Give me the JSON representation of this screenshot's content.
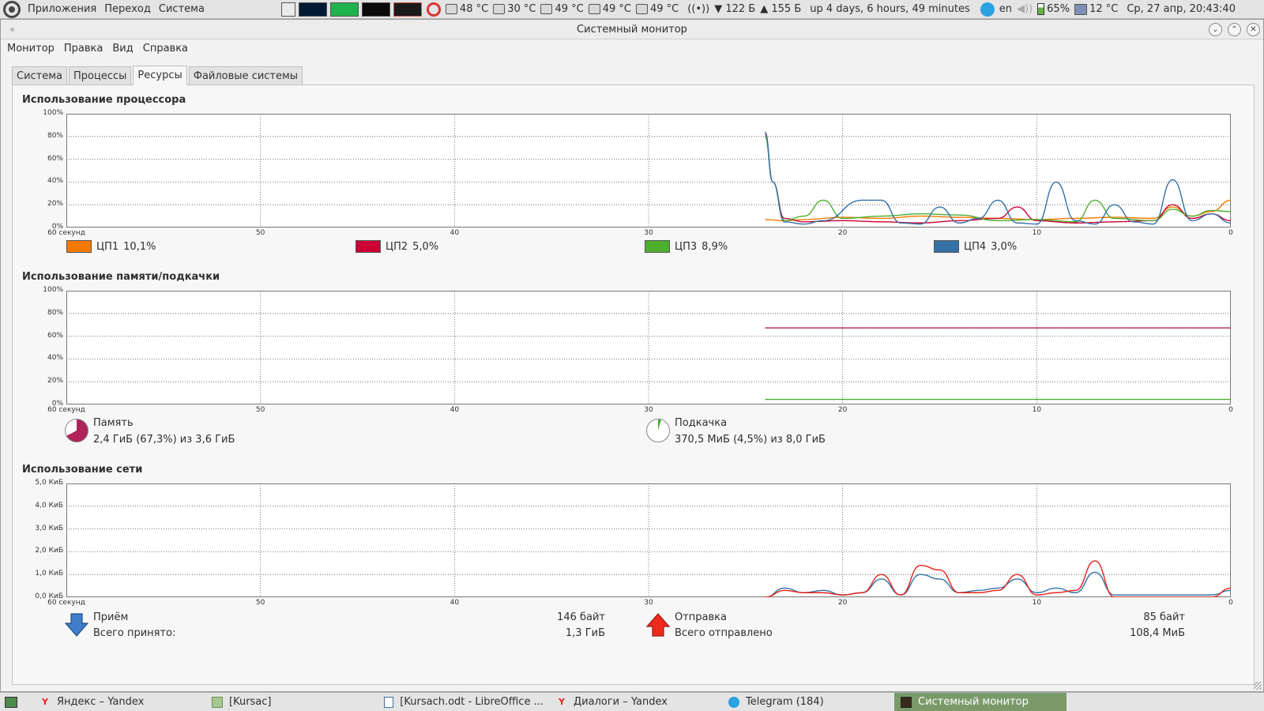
{
  "top_panel": {
    "menus": [
      "Приложения",
      "Переход",
      "Система"
    ],
    "temps": [
      "48 °C",
      "30 °C",
      "49 °C",
      "49 °C",
      "49 °C"
    ],
    "net_down": "122 Б",
    "net_up": "155 Б",
    "uptime": "up 4 days, 6 hours, 49 minutes",
    "layout": "en",
    "battery": "65%",
    "weather": "12 °C",
    "clock": "Ср, 27 апр, 20:43:40"
  },
  "window": {
    "title": "Системный монитор",
    "menu": [
      "Монитор",
      "Правка",
      "Вид",
      "Справка"
    ],
    "tabs": [
      "Система",
      "Процессы",
      "Ресурсы",
      "Файловые системы"
    ],
    "active_tab": 2
  },
  "x_axis": {
    "labels": [
      "60 секунд",
      "50",
      "40",
      "30",
      "20",
      "10",
      "0"
    ],
    "values": [
      60,
      50,
      40,
      30,
      20,
      10,
      0
    ]
  },
  "cpu": {
    "title": "Использование процессора",
    "y_labels": [
      "100%",
      "80%",
      "60%",
      "40%",
      "20%",
      "0%"
    ],
    "legend": [
      {
        "name": "ЦП1",
        "value": "10,1%",
        "color": "#f57900"
      },
      {
        "name": "ЦП2",
        "value": "5,0%",
        "color": "#cc0033"
      },
      {
        "name": "ЦП3",
        "value": "8,9%",
        "color": "#4caf2e"
      },
      {
        "name": "ЦП4",
        "value": "3,0%",
        "color": "#3371a6"
      }
    ]
  },
  "memory": {
    "title": "Использование памяти/подкачки",
    "y_labels": [
      "100%",
      "80%",
      "60%",
      "40%",
      "20%",
      "0%"
    ],
    "mem_label": "Память",
    "mem_value": "2,4 ГиБ (67,3%) из 3,6 ГиБ",
    "mem_color": "#b0225a",
    "mem_fraction": 0.673,
    "swap_label": "Подкачка",
    "swap_value": "370,5 МиБ (4,5%) из 8,0 ГиБ",
    "swap_color": "#4caf2e",
    "swap_fraction": 0.045
  },
  "network": {
    "title": "Использование сети",
    "y_labels": [
      "5,0 КиБ",
      "4,0 КиБ",
      "3,0 КиБ",
      "2,0 КиБ",
      "1,0 КиБ",
      "0,0 КиБ"
    ],
    "recv_label": "Приём",
    "recv_rate": "146 байт",
    "recv_total_label": "Всего принято:",
    "recv_total": "1,3 ГиБ",
    "recv_color": "#3371a6",
    "send_label": "Отправка",
    "send_rate": "85 байт",
    "send_total_label": "Всего отправлено",
    "send_total": "108,4 МиБ",
    "send_color": "#e8221a"
  },
  "chart_data": [
    {
      "type": "line",
      "title": "Использование процессора",
      "xlabel": "",
      "ylabel": "",
      "xlim": [
        60,
        0
      ],
      "ylim": [
        0,
        100
      ],
      "grid": true,
      "series": [
        {
          "name": "ЦП1",
          "x": [
            24,
            23,
            22,
            20,
            18,
            16,
            14,
            12,
            10,
            8,
            6,
            4,
            3,
            2,
            1,
            0
          ],
          "values": [
            7,
            6,
            7,
            9,
            8,
            10,
            9,
            8,
            7,
            8,
            9,
            8,
            18,
            10,
            14,
            24
          ]
        },
        {
          "name": "ЦП2",
          "x": [
            24,
            23.6,
            23,
            22,
            20,
            18,
            16,
            14,
            12,
            11,
            10,
            8,
            6,
            4,
            3,
            2,
            1,
            0
          ],
          "values": [
            82,
            40,
            8,
            5,
            6,
            5,
            4,
            6,
            8,
            18,
            6,
            4,
            5,
            6,
            20,
            8,
            12,
            6
          ]
        },
        {
          "name": "ЦП3",
          "x": [
            24,
            23.6,
            23,
            22,
            21,
            20,
            18,
            16,
            14,
            12,
            10,
            8,
            7,
            6,
            4,
            3,
            2,
            1,
            0
          ],
          "values": [
            80,
            40,
            6,
            10,
            24,
            8,
            10,
            12,
            11,
            6,
            7,
            5,
            24,
            8,
            6,
            16,
            10,
            15,
            14
          ]
        },
        {
          "name": "ЦП4",
          "x": [
            24,
            23.6,
            23,
            22,
            21,
            19,
            18,
            17,
            16,
            15,
            14,
            13,
            12,
            11,
            10,
            9,
            8,
            7,
            6,
            5,
            4,
            3,
            2,
            1,
            0
          ],
          "values": [
            84,
            40,
            5,
            3,
            6,
            24,
            24,
            4,
            3,
            18,
            4,
            8,
            24,
            4,
            3,
            40,
            6,
            3,
            20,
            5,
            3,
            42,
            6,
            12,
            4
          ]
        }
      ]
    },
    {
      "type": "line",
      "title": "Использование памяти/подкачки",
      "xlabel": "",
      "ylabel": "",
      "xlim": [
        60,
        0
      ],
      "ylim": [
        0,
        100
      ],
      "grid": true,
      "series": [
        {
          "name": "Память",
          "x": [
            24,
            0
          ],
          "values": [
            67.3,
            67.3
          ]
        },
        {
          "name": "Подкачка",
          "x": [
            24,
            0
          ],
          "values": [
            4.5,
            4.5
          ]
        }
      ]
    },
    {
      "type": "line",
      "title": "Использование сети",
      "xlabel": "",
      "ylabel": "",
      "xlim": [
        60,
        0
      ],
      "ylim": [
        0,
        5.0
      ],
      "grid": true,
      "series": [
        {
          "name": "Приём",
          "x": [
            24,
            23,
            22,
            21,
            20,
            19,
            18,
            17,
            16,
            15,
            14,
            13,
            12,
            11,
            10,
            9,
            8,
            7,
            6,
            5,
            4,
            3,
            2,
            1,
            0
          ],
          "values": [
            0.0,
            0.4,
            0.2,
            0.3,
            0.1,
            0.2,
            0.8,
            0.1,
            1.0,
            0.8,
            0.2,
            0.3,
            0.4,
            0.8,
            0.2,
            0.4,
            0.2,
            1.1,
            0.1,
            0.1,
            0.1,
            0.1,
            0.1,
            0.1,
            0.3
          ]
        },
        {
          "name": "Отправка",
          "x": [
            24,
            23,
            22,
            21,
            20,
            19,
            18,
            17,
            16,
            15,
            14,
            13,
            12,
            11,
            10,
            9,
            8,
            7,
            6,
            5,
            4,
            3,
            2,
            1,
            0
          ],
          "values": [
            0.0,
            0.3,
            0.2,
            0.2,
            0.1,
            0.2,
            1.0,
            0.1,
            1.4,
            1.2,
            0.2,
            0.2,
            0.3,
            1.0,
            0.1,
            0.2,
            0.3,
            1.6,
            0.0,
            0.0,
            0.0,
            0.0,
            0.0,
            0.0,
            0.4
          ]
        }
      ]
    }
  ],
  "taskbar": [
    {
      "label": "Яндекс – Yandex",
      "icon": "yandex-icon"
    },
    {
      "label": "[Kursac]",
      "icon": "folder-icon"
    },
    {
      "label": "[Kursach.odt - LibreOffice ...",
      "icon": "document-icon"
    },
    {
      "label": "Диалоги – Yandex",
      "icon": "yandex-icon"
    },
    {
      "label": "Telegram (184)",
      "icon": "telegram-icon"
    },
    {
      "label": "Системный монитор",
      "icon": "system-monitor-icon"
    }
  ]
}
